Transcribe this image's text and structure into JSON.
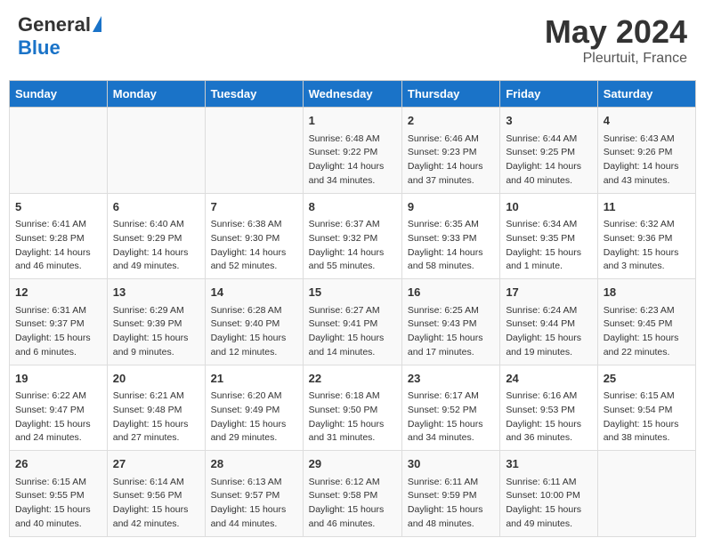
{
  "header": {
    "logo_general": "General",
    "logo_blue": "Blue",
    "title": "May 2024",
    "location": "Pleurtuit, France"
  },
  "columns": [
    "Sunday",
    "Monday",
    "Tuesday",
    "Wednesday",
    "Thursday",
    "Friday",
    "Saturday"
  ],
  "weeks": [
    [
      {
        "day": "",
        "info": ""
      },
      {
        "day": "",
        "info": ""
      },
      {
        "day": "",
        "info": ""
      },
      {
        "day": "1",
        "info": "Sunrise: 6:48 AM\nSunset: 9:22 PM\nDaylight: 14 hours and 34 minutes."
      },
      {
        "day": "2",
        "info": "Sunrise: 6:46 AM\nSunset: 9:23 PM\nDaylight: 14 hours and 37 minutes."
      },
      {
        "day": "3",
        "info": "Sunrise: 6:44 AM\nSunset: 9:25 PM\nDaylight: 14 hours and 40 minutes."
      },
      {
        "day": "4",
        "info": "Sunrise: 6:43 AM\nSunset: 9:26 PM\nDaylight: 14 hours and 43 minutes."
      }
    ],
    [
      {
        "day": "5",
        "info": "Sunrise: 6:41 AM\nSunset: 9:28 PM\nDaylight: 14 hours and 46 minutes."
      },
      {
        "day": "6",
        "info": "Sunrise: 6:40 AM\nSunset: 9:29 PM\nDaylight: 14 hours and 49 minutes."
      },
      {
        "day": "7",
        "info": "Sunrise: 6:38 AM\nSunset: 9:30 PM\nDaylight: 14 hours and 52 minutes."
      },
      {
        "day": "8",
        "info": "Sunrise: 6:37 AM\nSunset: 9:32 PM\nDaylight: 14 hours and 55 minutes."
      },
      {
        "day": "9",
        "info": "Sunrise: 6:35 AM\nSunset: 9:33 PM\nDaylight: 14 hours and 58 minutes."
      },
      {
        "day": "10",
        "info": "Sunrise: 6:34 AM\nSunset: 9:35 PM\nDaylight: 15 hours and 1 minute."
      },
      {
        "day": "11",
        "info": "Sunrise: 6:32 AM\nSunset: 9:36 PM\nDaylight: 15 hours and 3 minutes."
      }
    ],
    [
      {
        "day": "12",
        "info": "Sunrise: 6:31 AM\nSunset: 9:37 PM\nDaylight: 15 hours and 6 minutes."
      },
      {
        "day": "13",
        "info": "Sunrise: 6:29 AM\nSunset: 9:39 PM\nDaylight: 15 hours and 9 minutes."
      },
      {
        "day": "14",
        "info": "Sunrise: 6:28 AM\nSunset: 9:40 PM\nDaylight: 15 hours and 12 minutes."
      },
      {
        "day": "15",
        "info": "Sunrise: 6:27 AM\nSunset: 9:41 PM\nDaylight: 15 hours and 14 minutes."
      },
      {
        "day": "16",
        "info": "Sunrise: 6:25 AM\nSunset: 9:43 PM\nDaylight: 15 hours and 17 minutes."
      },
      {
        "day": "17",
        "info": "Sunrise: 6:24 AM\nSunset: 9:44 PM\nDaylight: 15 hours and 19 minutes."
      },
      {
        "day": "18",
        "info": "Sunrise: 6:23 AM\nSunset: 9:45 PM\nDaylight: 15 hours and 22 minutes."
      }
    ],
    [
      {
        "day": "19",
        "info": "Sunrise: 6:22 AM\nSunset: 9:47 PM\nDaylight: 15 hours and 24 minutes."
      },
      {
        "day": "20",
        "info": "Sunrise: 6:21 AM\nSunset: 9:48 PM\nDaylight: 15 hours and 27 minutes."
      },
      {
        "day": "21",
        "info": "Sunrise: 6:20 AM\nSunset: 9:49 PM\nDaylight: 15 hours and 29 minutes."
      },
      {
        "day": "22",
        "info": "Sunrise: 6:18 AM\nSunset: 9:50 PM\nDaylight: 15 hours and 31 minutes."
      },
      {
        "day": "23",
        "info": "Sunrise: 6:17 AM\nSunset: 9:52 PM\nDaylight: 15 hours and 34 minutes."
      },
      {
        "day": "24",
        "info": "Sunrise: 6:16 AM\nSunset: 9:53 PM\nDaylight: 15 hours and 36 minutes."
      },
      {
        "day": "25",
        "info": "Sunrise: 6:15 AM\nSunset: 9:54 PM\nDaylight: 15 hours and 38 minutes."
      }
    ],
    [
      {
        "day": "26",
        "info": "Sunrise: 6:15 AM\nSunset: 9:55 PM\nDaylight: 15 hours and 40 minutes."
      },
      {
        "day": "27",
        "info": "Sunrise: 6:14 AM\nSunset: 9:56 PM\nDaylight: 15 hours and 42 minutes."
      },
      {
        "day": "28",
        "info": "Sunrise: 6:13 AM\nSunset: 9:57 PM\nDaylight: 15 hours and 44 minutes."
      },
      {
        "day": "29",
        "info": "Sunrise: 6:12 AM\nSunset: 9:58 PM\nDaylight: 15 hours and 46 minutes."
      },
      {
        "day": "30",
        "info": "Sunrise: 6:11 AM\nSunset: 9:59 PM\nDaylight: 15 hours and 48 minutes."
      },
      {
        "day": "31",
        "info": "Sunrise: 6:11 AM\nSunset: 10:00 PM\nDaylight: 15 hours and 49 minutes."
      },
      {
        "day": "",
        "info": ""
      }
    ]
  ]
}
